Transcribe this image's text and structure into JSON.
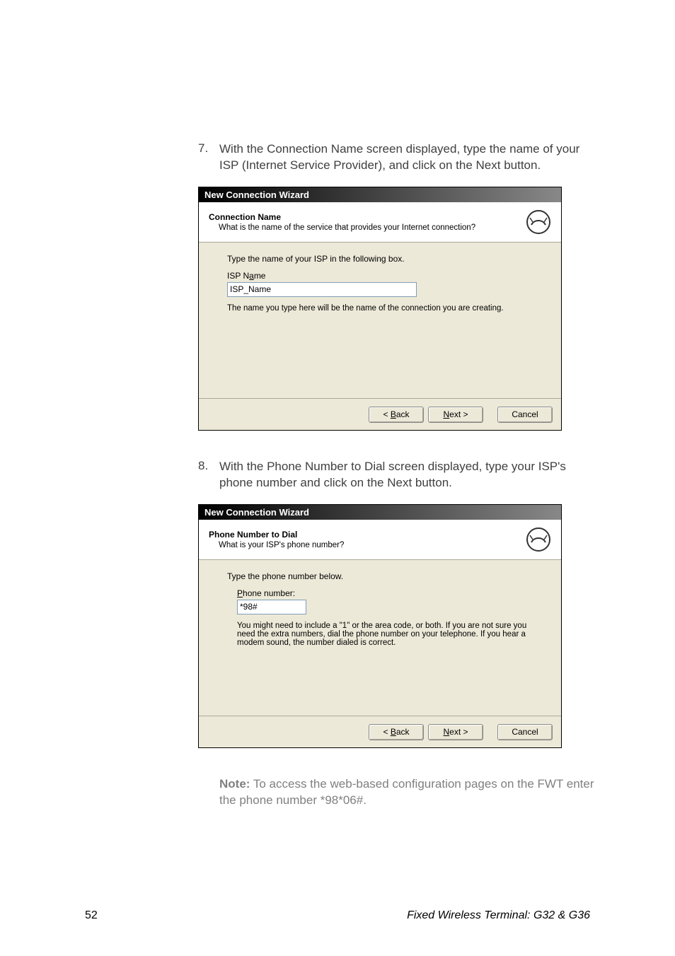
{
  "steps": {
    "s7": {
      "num": "7.",
      "text": "With the Connection Name screen displayed, type the name of your ISP (Internet Service Provider), and click on the Next button."
    },
    "s8": {
      "num": "8.",
      "text": "With the Phone Number to Dial screen displayed, type your ISP's phone number and click on the Next button."
    }
  },
  "dialog1": {
    "title": "New Connection Wizard",
    "headerTitle": "Connection Name",
    "headerSub": "What is the name of the service that provides your Internet connection?",
    "instr": "Type the name of your ISP in the following box.",
    "fieldLabelPre": "ISP N",
    "fieldLabelAccel": "a",
    "fieldLabelPost": "me",
    "fieldValue": "ISP_Name",
    "help": "The name you type here will be the name of the connection you are creating.",
    "backPre": "< ",
    "backAccel": "B",
    "backPost": "ack",
    "nextAccel": "N",
    "nextPost": "ext >",
    "cancel": "Cancel"
  },
  "dialog2": {
    "title": "New Connection Wizard",
    "headerTitle": "Phone Number to Dial",
    "headerSub": "What is your ISP's phone number?",
    "instr": "Type the phone number below.",
    "fieldLabelAccel": "P",
    "fieldLabelPost": "hone number:",
    "fieldValue": "*98#",
    "help": "You might need to include a \"1\" or the area code, or both. If you are not sure you need the extra numbers, dial the phone number on your telephone. If you hear a modem sound, the number dialed is correct.",
    "backPre": "< ",
    "backAccel": "B",
    "backPost": "ack",
    "nextAccel": "N",
    "nextPost": "ext >",
    "cancel": "Cancel"
  },
  "note": {
    "label": "Note:",
    "text": " To access the web-based configuration pages on the FWT enter the phone number *98*06#."
  },
  "footer": {
    "page": "52",
    "title": "Fixed Wireless Terminal: G32 & G36"
  }
}
